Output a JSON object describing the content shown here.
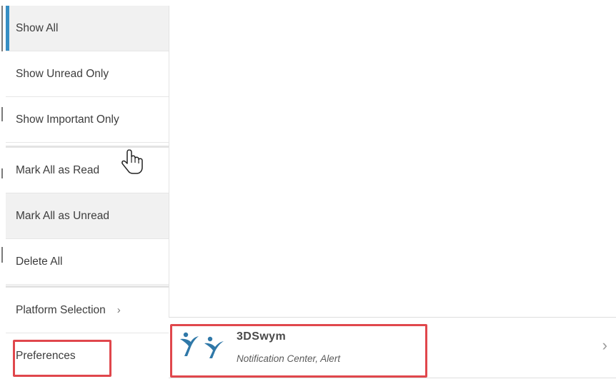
{
  "menu": {
    "items": [
      {
        "label": "Show All"
      },
      {
        "label": "Show Unread Only"
      },
      {
        "label": "Show Important Only"
      },
      {
        "label": "Mark All as Read"
      },
      {
        "label": "Mark All as Unread"
      },
      {
        "label": "Delete All"
      },
      {
        "label": "Platform Selection",
        "chevron": "›"
      },
      {
        "label": "Preferences"
      }
    ],
    "active_item": "Show All",
    "accent_color": "#368ec4"
  },
  "platform": {
    "app_name": "3DSwym",
    "app_desc": "Notification Center, Alert",
    "logo_icon": "3dswym-logo-icon",
    "chevron": "›"
  },
  "highlights": {
    "color": "#e0474c",
    "targets": [
      "Preferences",
      "3DSwym"
    ]
  },
  "cursor": {
    "icon": "hand-pointer-icon"
  }
}
